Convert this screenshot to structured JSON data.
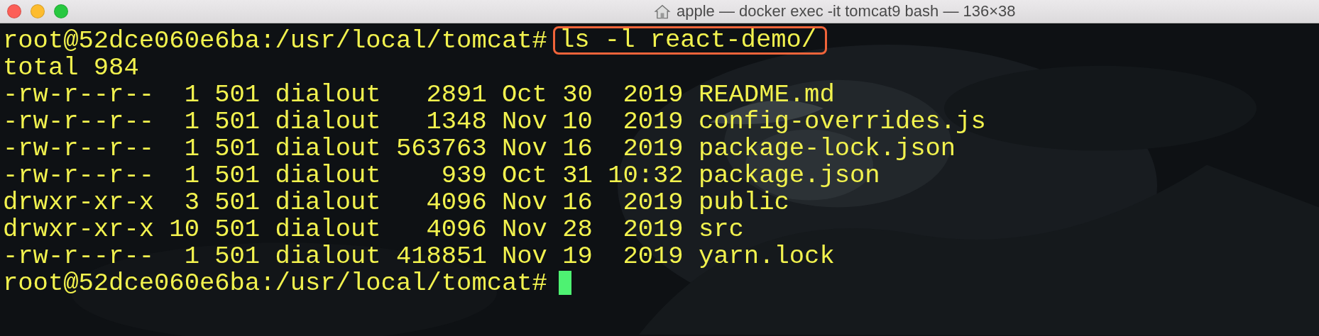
{
  "window": {
    "title": "apple — docker exec -it tomcat9 bash — 136×38"
  },
  "terminal": {
    "kind": "picture",
    "lines": [
      {
        "kind": "prompt",
        "prompt": "root@52dce060e6ba:/usr/local/tomcat#",
        "command": "ls -l react-demo/",
        "highlighted": true,
        "cursor": false
      },
      {
        "kind": "output",
        "text": "total 984"
      },
      {
        "kind": "output",
        "text": "-rw-r--r--  1 501 dialout   2891 Oct 30  2019 README.md"
      },
      {
        "kind": "output",
        "text": "-rw-r--r--  1 501 dialout   1348 Nov 10  2019 config-overrides.js"
      },
      {
        "kind": "output",
        "text": "-rw-r--r--  1 501 dialout 563763 Nov 16  2019 package-lock.json"
      },
      {
        "kind": "output",
        "text": "-rw-r--r--  1 501 dialout    939 Oct 31 10:32 package.json"
      },
      {
        "kind": "output",
        "text": "drwxr-xr-x  3 501 dialout   4096 Nov 16  2019 public"
      },
      {
        "kind": "output",
        "text": "drwxr-xr-x 10 501 dialout   4096 Nov 28  2019 src"
      },
      {
        "kind": "output",
        "text": "-rw-r--r--  1 501 dialout 418851 Nov 19  2019 yarn.lock"
      },
      {
        "kind": "prompt",
        "prompt": "root@52dce060e6ba:/usr/local/tomcat#",
        "highlighted": false,
        "cursor": true
      }
    ]
  }
}
